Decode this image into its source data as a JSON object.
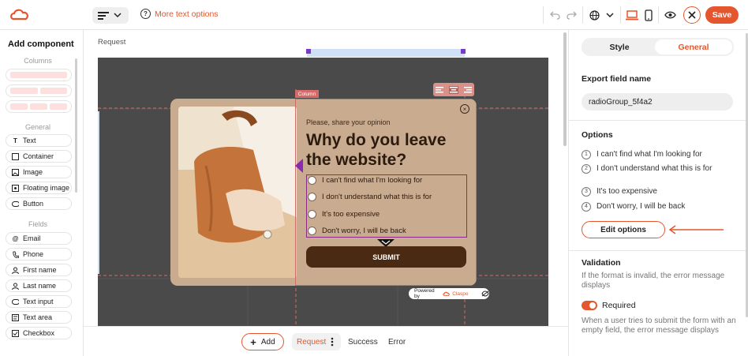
{
  "colors": {
    "accent": "#e4572e",
    "canvas_bg": "#4a4a4a",
    "popup_bg": "#c9ab90",
    "submit_bg": "#4a2a12"
  },
  "toolbar": {
    "more_text_options": "More text options",
    "save_label": "Save",
    "icons": [
      "logo-icon",
      "align-left-icon",
      "chevron-down-icon",
      "help-icon",
      "undo-icon",
      "redo-icon",
      "globe-icon",
      "chevron-down-icon",
      "desktop-icon",
      "mobile-icon",
      "eye-icon",
      "close-icon"
    ]
  },
  "left_panel": {
    "title": "Add component",
    "columns_title": "Columns",
    "general_title": "General",
    "general_items": [
      {
        "label": "Text",
        "icon": "text-icon"
      },
      {
        "label": "Container",
        "icon": "container-icon"
      },
      {
        "label": "Image",
        "icon": "image-icon"
      },
      {
        "label": "Floating image",
        "icon": "floating-image-icon"
      },
      {
        "label": "Button",
        "icon": "button-icon"
      }
    ],
    "fields_title": "Fields",
    "field_items": [
      {
        "label": "Email",
        "icon": "at-icon"
      },
      {
        "label": "Phone",
        "icon": "phone-icon"
      },
      {
        "label": "First name",
        "icon": "user-icon"
      },
      {
        "label": "Last name",
        "icon": "user-icon"
      },
      {
        "label": "Text input",
        "icon": "input-icon"
      },
      {
        "label": "Text area",
        "icon": "textarea-icon"
      },
      {
        "label": "Checkbox",
        "icon": "checkbox-icon"
      }
    ]
  },
  "canvas": {
    "breadcrumb": "Request",
    "column_label": "Column",
    "popup": {
      "subtitle": "Please, share your opinion",
      "title": "Why do you leave the website?",
      "options": [
        "I can't find what I'm looking for",
        "I don't understand what this is for",
        "It's too expensive",
        "Don't worry, I will be back"
      ],
      "submit": "SUBMIT",
      "powered_by": "Powered by",
      "brand": "Claspo"
    }
  },
  "bottom_bar": {
    "add_label": "Add",
    "tabs": [
      "Request",
      "Success",
      "Error"
    ],
    "active_tab": "Request"
  },
  "right_panel": {
    "tab_style": "Style",
    "tab_general": "General",
    "export_label": "Export field name",
    "export_value": "radioGroup_5f4a2",
    "options_label": "Options",
    "options": [
      {
        "num": "1",
        "text": "I can't find what I'm looking for"
      },
      {
        "num": "2",
        "text": "I don't understand what this is for"
      },
      {
        "num": "3",
        "text": "It's too expensive"
      },
      {
        "num": "4",
        "text": "Don't worry, I will be back"
      }
    ],
    "edit_options": "Edit options",
    "validation_label": "Validation",
    "validation_desc": "If the format is invalid, the error message displays",
    "required_label": "Required",
    "required_on": true,
    "required_desc": "When a user tries to submit the form with an empty field, the error message displays"
  }
}
